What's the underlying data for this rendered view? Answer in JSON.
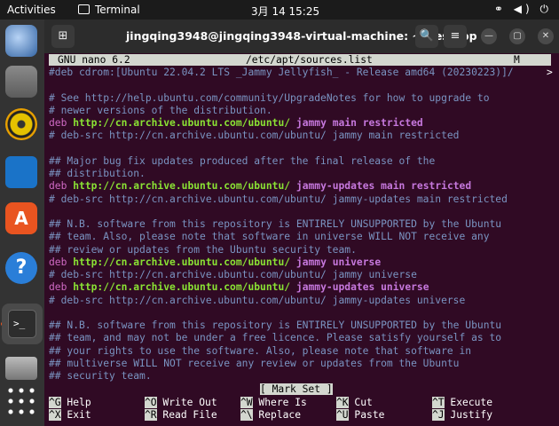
{
  "topbar": {
    "activities": "Activities",
    "app": "Terminal",
    "clock": "3月 14  15:25",
    "tray": "⚭ ◀) ⏻"
  },
  "dock": {
    "icons": [
      "thunderbird-icon",
      "files-icon",
      "rhythmbox-icon",
      "libreoffice-writer-icon",
      "app-center-icon",
      "help-icon",
      "terminal-icon",
      "drive-icon",
      "show-apps-icon"
    ]
  },
  "window": {
    "title": "jingqing3948@jingqing3948-virtual-machine: ~/Desktop",
    "new_tab": "⊞",
    "search": "🔍",
    "menu": "≡",
    "minimize": "—",
    "maximize": "▢",
    "close": "✕"
  },
  "nano": {
    "version": "GNU nano 6.2",
    "file": "/etc/apt/sources.list",
    "modified": "M",
    "lines": [
      {
        "t": "c",
        "text": "#deb cdrom:[Ubuntu 22.04.2 LTS _Jammy Jellyfish_ - Release amd64 (20230223)]/"
      },
      {
        "t": "blank",
        "text": ""
      },
      {
        "t": "c",
        "text": "# See http://help.ubuntu.com/community/UpgradeNotes for how to upgrade to"
      },
      {
        "t": "c",
        "text": "# newer versions of the distribution."
      },
      {
        "t": "deb",
        "kw": "deb",
        "url": "http://cn.archive.ubuntu.com/ubuntu/",
        "dist": "jammy",
        "comp": "main restricted"
      },
      {
        "t": "c",
        "text": "# deb-src http://cn.archive.ubuntu.com/ubuntu/ jammy main restricted"
      },
      {
        "t": "blank",
        "text": ""
      },
      {
        "t": "c",
        "text": "## Major bug fix updates produced after the final release of the"
      },
      {
        "t": "c",
        "text": "## distribution."
      },
      {
        "t": "deb",
        "kw": "deb",
        "url": "http://cn.archive.ubuntu.com/ubuntu/",
        "dist": "jammy-updates",
        "comp": "main restricted"
      },
      {
        "t": "c",
        "text": "# deb-src http://cn.archive.ubuntu.com/ubuntu/ jammy-updates main restricted"
      },
      {
        "t": "blank",
        "text": ""
      },
      {
        "t": "c",
        "text": "## N.B. software from this repository is ENTIRELY UNSUPPORTED by the Ubuntu"
      },
      {
        "t": "c",
        "text": "## team. Also, please note that software in universe WILL NOT receive any"
      },
      {
        "t": "c",
        "text": "## review or updates from the Ubuntu security team."
      },
      {
        "t": "deb",
        "kw": "deb",
        "url": "http://cn.archive.ubuntu.com/ubuntu/",
        "dist": "jammy",
        "comp": "universe"
      },
      {
        "t": "c",
        "text": "# deb-src http://cn.archive.ubuntu.com/ubuntu/ jammy universe"
      },
      {
        "t": "deb",
        "kw": "deb",
        "url": "http://cn.archive.ubuntu.com/ubuntu/",
        "dist": "jammy-updates",
        "comp": "universe"
      },
      {
        "t": "c",
        "text": "# deb-src http://cn.archive.ubuntu.com/ubuntu/ jammy-updates universe"
      },
      {
        "t": "blank",
        "text": ""
      },
      {
        "t": "c",
        "text": "## N.B. software from this repository is ENTIRELY UNSUPPORTED by the Ubuntu"
      },
      {
        "t": "c",
        "text": "## team, and may not be under a free licence. Please satisfy yourself as to"
      },
      {
        "t": "c",
        "text": "## your rights to use the software. Also, please note that software in"
      },
      {
        "t": "c",
        "text": "## multiverse WILL NOT receive any review or updates from the Ubuntu"
      },
      {
        "t": "c",
        "text": "## security team."
      }
    ],
    "overflow_marker": ">",
    "status": "[ Mark Set ]",
    "shortcuts_row1": [
      {
        "key": "^G",
        "label": "Help"
      },
      {
        "key": "^O",
        "label": "Write Out"
      },
      {
        "key": "^W",
        "label": "Where Is"
      },
      {
        "key": "^K",
        "label": "Cut"
      },
      {
        "key": "^T",
        "label": "Execute"
      }
    ],
    "shortcuts_row2": [
      {
        "key": "^X",
        "label": "Exit"
      },
      {
        "key": "^R",
        "label": "Read File"
      },
      {
        "key": "^\\",
        "label": "Replace"
      },
      {
        "key": "^U",
        "label": "Paste"
      },
      {
        "key": "^J",
        "label": "Justify"
      }
    ]
  }
}
